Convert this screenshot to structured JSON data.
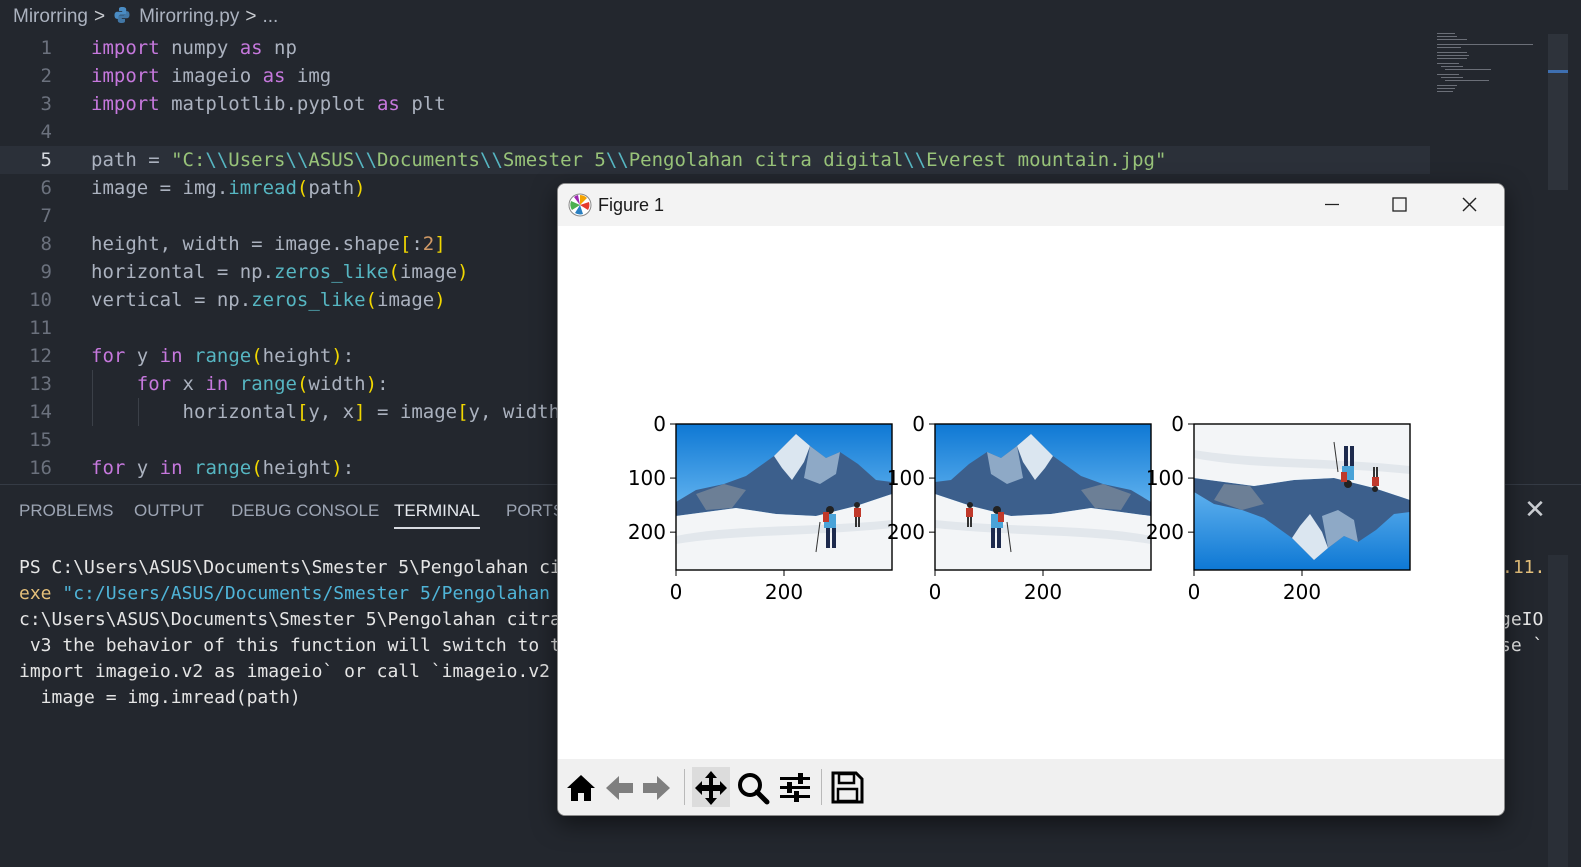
{
  "breadcrumb": {
    "folder": "Mirorring",
    "file": "Mirorring.py",
    "more": "..."
  },
  "editor": {
    "lines": [
      {
        "n": "1",
        "text": "import numpy as np"
      },
      {
        "n": "2",
        "text": "import imageio as img"
      },
      {
        "n": "3",
        "text": "import matplotlib.pyplot as plt"
      },
      {
        "n": "4",
        "text": ""
      },
      {
        "n": "5",
        "text": "path = \"C:\\\\Users\\\\ASUS\\\\Documents\\\\Smester 5\\\\Pengolahan citra digital\\\\Everest mountain.jpg\""
      },
      {
        "n": "6",
        "text": "image = img.imread(path)"
      },
      {
        "n": "7",
        "text": ""
      },
      {
        "n": "8",
        "text": "height, width = image.shape[:2]"
      },
      {
        "n": "9",
        "text": "horizontal = np.zeros_like(image)"
      },
      {
        "n": "10",
        "text": "vertical = np.zeros_like(image)"
      },
      {
        "n": "11",
        "text": ""
      },
      {
        "n": "12",
        "text": "for y in range(height):"
      },
      {
        "n": "13",
        "text": "    for x in range(width):"
      },
      {
        "n": "14",
        "text": "        horizontal[y, x] = image[y, width"
      },
      {
        "n": "15",
        "text": ""
      },
      {
        "n": "16",
        "text": "for y in range(height):"
      }
    ]
  },
  "panel": {
    "tabs": [
      "PROBLEMS",
      "OUTPUT",
      "DEBUG CONSOLE",
      "TERMINAL",
      "PORTS"
    ],
    "active_tab": "TERMINAL",
    "close_glyph": "✕",
    "terminal": {
      "l1": "PS C:\\Users\\ASUS\\Documents\\Smester 5\\Pengolahan ci",
      "l2a": "exe ",
      "l2b": "\"c:/Users/ASUS/Documents/Smester 5/Pengolahan",
      "l3": "c:\\Users\\ASUS\\Documents\\Smester 5\\Pengolahan citra",
      "l4": " v3 the behavior of this function will switch to t",
      "l5": "import imageio.v2 as imageio` or call `imageio.v2",
      "l6": "  image = img.imread(path)",
      "r1": ".11.",
      "r3": "geIO",
      "r4": "se `"
    }
  },
  "figure": {
    "title": "Figure 1",
    "toolbar": [
      "home",
      "back",
      "forward",
      "pan",
      "zoom",
      "configure-subplots",
      "save"
    ]
  },
  "chart_data": [
    {
      "type": "image",
      "title": "",
      "content": "Everest mountain (original)",
      "yticks": [
        "0",
        "100",
        "200"
      ],
      "xticks": [
        "0",
        "200"
      ]
    },
    {
      "type": "image",
      "title": "",
      "content": "horizontal mirror",
      "yticks": [
        "0",
        "100",
        "200"
      ],
      "xticks": [
        "0",
        "200"
      ]
    },
    {
      "type": "image",
      "title": "",
      "content": "vertical mirror",
      "yticks": [
        "0",
        "100",
        "200"
      ],
      "xticks": [
        "0",
        "200"
      ]
    }
  ],
  "colors": {
    "editor_bg": "#23272e",
    "keyword": "#c678dd",
    "string": "#98c379",
    "function": "#56b6c2",
    "sky": "#1e88d8"
  }
}
